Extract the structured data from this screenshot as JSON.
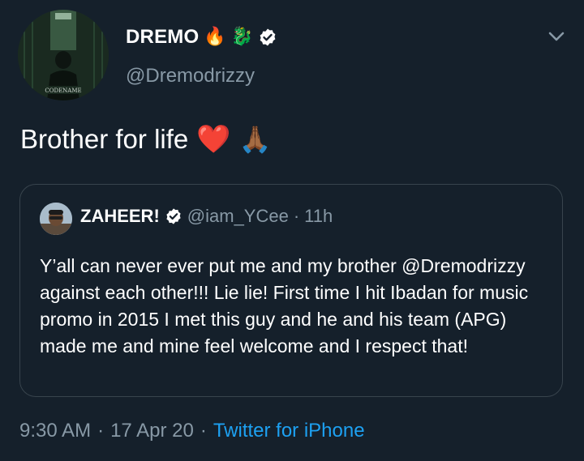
{
  "author": {
    "display_name": "DREMO",
    "name_emojis": [
      "🔥",
      "🐉"
    ],
    "verified_icon": "verified-badge-icon",
    "handle": "@Dremodrizzy",
    "avatar_caption": "CODENAME"
  },
  "tweet": {
    "text": "Brother for life",
    "emojis": [
      "❤️",
      "🙏🏾"
    ]
  },
  "quoted_tweet": {
    "display_name": "ZAHEER!",
    "verified_icon": "verified-badge-icon",
    "handle": "@iam_YCee",
    "separator": "·",
    "time_ago": "11h",
    "text": "Y’all can never ever put me and my brother @Dremodrizzy against each other!!! Lie lie! First time I hit Ibadan for music promo in 2015 I met this guy and he and his team (APG) made me and mine feel welcome and I respect that!"
  },
  "meta": {
    "time": "9:30 AM",
    "sep1": "·",
    "date": "17 Apr 20",
    "sep2": "·",
    "source": "Twitter for iPhone"
  },
  "colors": {
    "background": "#15202b",
    "secondary_text": "#8899a6",
    "link": "#1da1f2",
    "border": "#38444d"
  }
}
